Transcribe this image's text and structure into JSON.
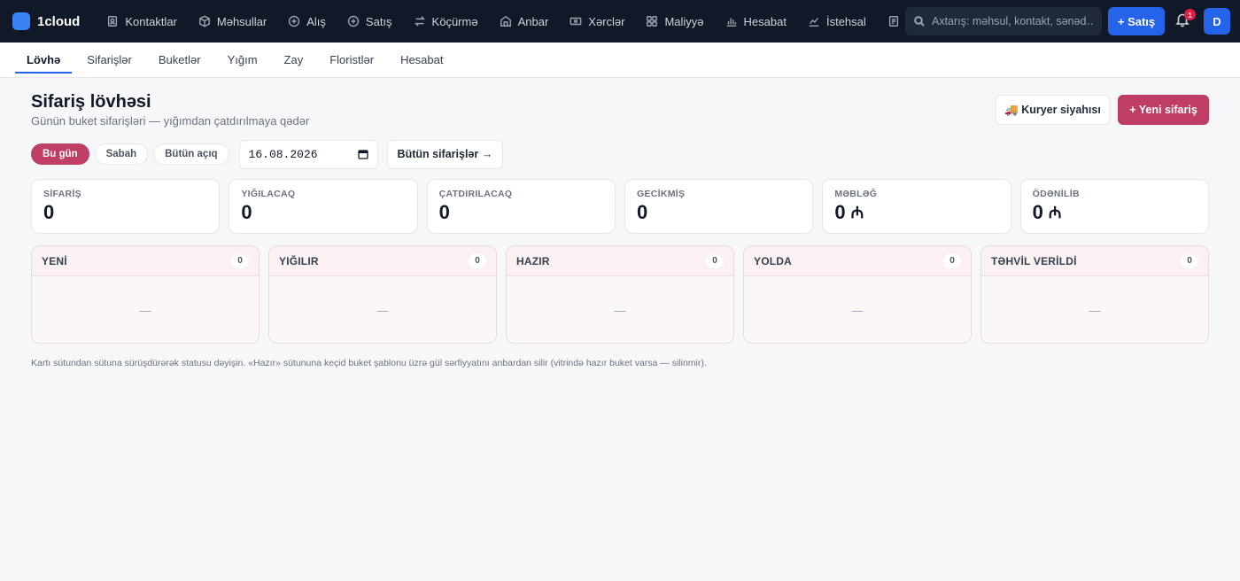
{
  "brand": {
    "name": "1cloud",
    "color": "#3b82f6"
  },
  "nav": [
    {
      "label": "Kontaktlar",
      "icon": "contacts-icon"
    },
    {
      "label": "Məhsullar",
      "icon": "box-icon"
    },
    {
      "label": "Alış",
      "icon": "plus-circle-icon"
    },
    {
      "label": "Satış",
      "icon": "plus-circle-icon"
    },
    {
      "label": "Köçürmə",
      "icon": "transfer-icon"
    },
    {
      "label": "Anbar",
      "icon": "warehouse-icon"
    },
    {
      "label": "Xərclər",
      "icon": "money-icon"
    },
    {
      "label": "Maliyyə",
      "icon": "grid-icon"
    },
    {
      "label": "Hesabat",
      "icon": "bar-chart-icon"
    },
    {
      "label": "İstehsal",
      "icon": "line-chart-icon"
    }
  ],
  "search": {
    "placeholder": "Axtarış: məhsul, kontakt, sənəd…"
  },
  "header": {
    "sale_button": "+ Satış",
    "notifications_count": "1",
    "avatar_initial": "D"
  },
  "subtabs": [
    "Lövhə",
    "Sifarişlər",
    "Buketlər",
    "Yığım",
    "Zay",
    "Floristlər",
    "Hesabat"
  ],
  "page": {
    "title": "Sifariş lövhəsi",
    "subtitle": "Günün buket sifarişləri — yığımdan çatdırılmaya qədər",
    "courier_button": "🚚 Kuryer siyahısı",
    "new_order_button": "+ Yeni sifariş"
  },
  "filters": {
    "pills": [
      "Bu gün",
      "Sabah",
      "Bütün açıq"
    ],
    "active_pill": "Bu gün",
    "date": "16.08.2026",
    "all_orders_button": "Bütün sifarişlər →"
  },
  "stats": [
    {
      "label": "SİFARİŞ",
      "value": "0",
      "currency": ""
    },
    {
      "label": "YIĞILACAQ",
      "value": "0",
      "currency": ""
    },
    {
      "label": "ÇATDIRILACAQ",
      "value": "0",
      "currency": ""
    },
    {
      "label": "GECİKMİŞ",
      "value": "0",
      "currency": ""
    },
    {
      "label": "MƏBLƏĞ",
      "value": "0",
      "currency": "₼"
    },
    {
      "label": "ÖDƏNİLİB",
      "value": "0",
      "currency": "₼"
    }
  ],
  "kanban": [
    {
      "title": "YENİ",
      "count": "0",
      "empty": "—"
    },
    {
      "title": "YIĞILIR",
      "count": "0",
      "empty": "—"
    },
    {
      "title": "HAZIR",
      "count": "0",
      "empty": "—"
    },
    {
      "title": "YOLDA",
      "count": "0",
      "empty": "—"
    },
    {
      "title": "TƏHVİL VERİLDİ",
      "count": "0",
      "empty": "—"
    }
  ],
  "hint": "Kartı sütundan sütuna sürüşdürərək statusu dəyişin. «Hazır» sütununa keçid buket şablonu üzrə gül sərfiyyatını anbardan silir (vitrində hazır buket varsa — silinmir).",
  "colors": {
    "topbar": "#111827",
    "primary": "#2563eb",
    "accent": "#be3e64",
    "badge": "#e11d48"
  }
}
